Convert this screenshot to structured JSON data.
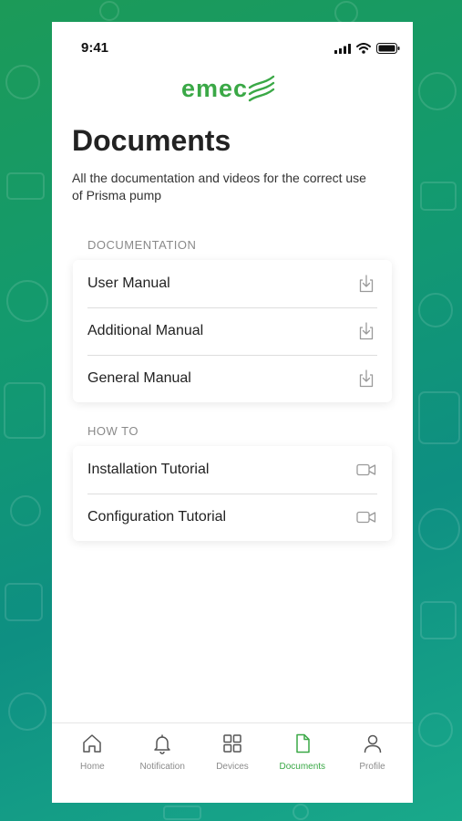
{
  "status_bar": {
    "time": "9:41"
  },
  "brand": {
    "logo_text": "emec",
    "accent_color": "#3aa846"
  },
  "header": {
    "title": "Documents",
    "subtitle": "All the documentation and videos for the correct use of Prisma pump"
  },
  "sections": [
    {
      "title": "DOCUMENTATION",
      "items": [
        {
          "label": "User Manual",
          "icon": "download-icon"
        },
        {
          "label": "Additional Manual",
          "icon": "download-icon"
        },
        {
          "label": "General Manual",
          "icon": "download-icon"
        }
      ]
    },
    {
      "title": "HOW TO",
      "items": [
        {
          "label": "Installation Tutorial",
          "icon": "video-icon"
        },
        {
          "label": "Configuration Tutorial",
          "icon": "video-icon"
        }
      ]
    }
  ],
  "tab_bar": {
    "active": "Documents",
    "tabs": [
      {
        "label": "Home",
        "icon": "home-icon"
      },
      {
        "label": "Notification",
        "icon": "bell-icon"
      },
      {
        "label": "Devices",
        "icon": "grid-icon"
      },
      {
        "label": "Documents",
        "icon": "document-icon"
      },
      {
        "label": "Profile",
        "icon": "person-icon"
      }
    ]
  }
}
